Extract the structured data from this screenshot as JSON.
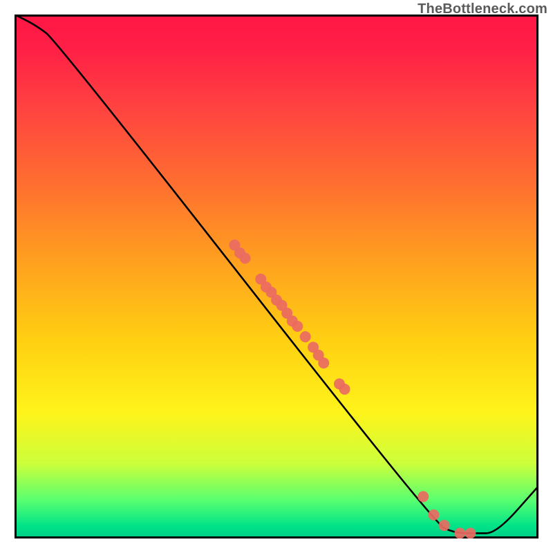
{
  "watermark": "TheBottleneck.com",
  "chart_data": {
    "type": "line",
    "title": "",
    "xlabel": "",
    "ylabel": "",
    "xlim": [
      0,
      100
    ],
    "ylim": [
      0,
      100
    ],
    "curve": {
      "name": "bottleneck-curve",
      "x": [
        0,
        4,
        8,
        80,
        84,
        88,
        92,
        100
      ],
      "y": [
        100,
        98,
        95,
        3,
        1,
        1,
        1,
        10
      ]
    },
    "points": {
      "name": "data-points",
      "color": "#ea6a62",
      "radius": 8,
      "xy": [
        [
          42,
          56
        ],
        [
          43,
          54.5
        ],
        [
          44,
          53.5
        ],
        [
          47,
          49.5
        ],
        [
          48,
          48
        ],
        [
          49,
          47
        ],
        [
          50,
          45.5
        ],
        [
          51,
          44.5
        ],
        [
          52,
          43
        ],
        [
          53,
          41.5
        ],
        [
          54,
          40.5
        ],
        [
          55.5,
          38.5
        ],
        [
          57,
          36.5
        ],
        [
          58,
          35
        ],
        [
          59,
          33.5
        ],
        [
          62,
          29.5
        ],
        [
          63,
          28.5
        ],
        [
          78,
          8
        ],
        [
          80,
          4.5
        ],
        [
          82,
          2.5
        ],
        [
          85,
          1
        ],
        [
          87,
          1
        ]
      ]
    }
  }
}
